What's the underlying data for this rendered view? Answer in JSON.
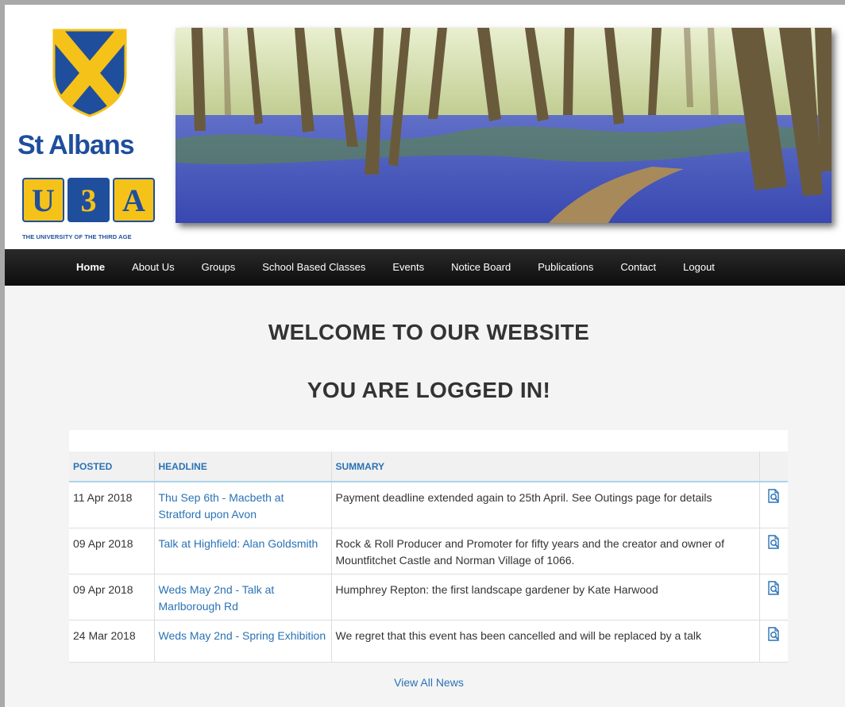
{
  "brand": {
    "name": "St Albans",
    "u3a_letters": [
      "U",
      "3",
      "A"
    ],
    "tagline": "THE UNIVERSITY OF THE THIRD AGE",
    "colors": {
      "blue": "#1f4e9c",
      "yellow": "#f5c21a"
    }
  },
  "banner": {
    "icon": "bluebell-woodland-photo"
  },
  "nav": {
    "items": [
      {
        "label": "Home",
        "active": true
      },
      {
        "label": "About Us"
      },
      {
        "label": "Groups"
      },
      {
        "label": "School Based Classes"
      },
      {
        "label": "Events"
      },
      {
        "label": "Notice Board"
      },
      {
        "label": "Publications"
      },
      {
        "label": "Contact"
      },
      {
        "label": "Logout"
      }
    ]
  },
  "main": {
    "welcome": "WELCOME TO OUR WEBSITE",
    "logged_in": "YOU ARE LOGGED IN!"
  },
  "news": {
    "columns": {
      "posted": "POSTED",
      "headline": "HEADLINE",
      "summary": "SUMMARY"
    },
    "rows": [
      {
        "posted": "11 Apr 2018",
        "headline": "Thu Sep 6th - Macbeth at Stratford upon Avon",
        "summary": "Payment deadline extended again to 25th April. See Outings page for details"
      },
      {
        "posted": "09 Apr 2018",
        "headline": "Talk at Highfield: Alan Goldsmith",
        "summary": "Rock & Roll Producer and Promoter for fifty years and the creator and owner of Mountfitchet Castle and Norman Village of 1066."
      },
      {
        "posted": "09 Apr 2018",
        "headline": "Weds May 2nd - Talk at Marlborough Rd",
        "summary": "Humphrey Repton: the first landscape gardener by Kate Harwood"
      },
      {
        "posted": "24 Mar 2018",
        "headline": "Weds May 2nd - Spring Exhibition",
        "summary": "We regret that this event has been cancelled and will be replaced by a talk"
      }
    ],
    "row_icon": "document-view-icon",
    "view_all": "View All News"
  }
}
